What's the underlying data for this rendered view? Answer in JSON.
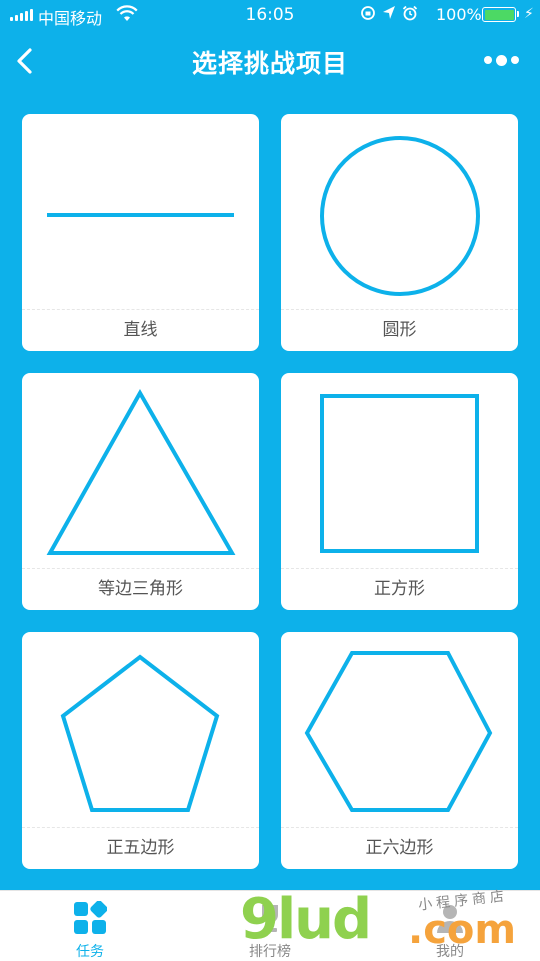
{
  "status_bar": {
    "carrier": "中国移动",
    "time": "16:05",
    "battery_percent": "100%",
    "battery_level": 1.0,
    "icons": [
      "signal-icon",
      "wifi-icon",
      "rotation-lock-icon",
      "location-icon",
      "alarm-icon",
      "battery-icon",
      "charging-icon"
    ]
  },
  "nav": {
    "title": "选择挑战项目",
    "back_icon": "chevron-left-icon",
    "more_icon": "more-dots-icon"
  },
  "colors": {
    "primary": "#0db1ea",
    "card_bg": "#ffffff",
    "label_text": "#555555"
  },
  "shapes": [
    {
      "id": "line",
      "label": "直线",
      "icon": "line-shape-icon"
    },
    {
      "id": "circle",
      "label": "圆形",
      "icon": "circle-shape-icon"
    },
    {
      "id": "triangle",
      "label": "等边三角形",
      "icon": "triangle-shape-icon"
    },
    {
      "id": "square",
      "label": "正方形",
      "icon": "square-shape-icon"
    },
    {
      "id": "pentagon",
      "label": "正五边形",
      "icon": "pentagon-shape-icon"
    },
    {
      "id": "hexagon",
      "label": "正六边形",
      "icon": "hexagon-shape-icon"
    }
  ],
  "tabs": [
    {
      "label": "任务",
      "icon": "tasks-grid-icon",
      "active": true
    },
    {
      "label": "排行榜",
      "icon": "trophy-icon",
      "active": false
    },
    {
      "label": "我的",
      "icon": "user-icon",
      "active": false
    }
  ],
  "watermark": {
    "main": "9lud",
    "suffix": ".com",
    "small": "小程序商店"
  }
}
